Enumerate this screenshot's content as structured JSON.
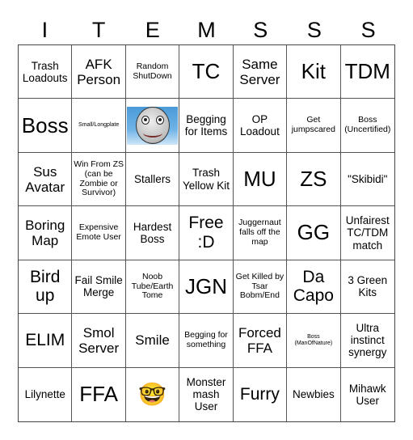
{
  "title_letters": [
    "I",
    "T",
    "E",
    "M",
    "S",
    "S",
    "S"
  ],
  "cells": [
    {
      "text": "Trash Loadouts",
      "size": "s-m"
    },
    {
      "text": "AFK Person",
      "size": "s-l"
    },
    {
      "text": "Random ShutDown",
      "size": "s-s"
    },
    {
      "text": "TC",
      "size": "s-xxl"
    },
    {
      "text": "Same Server",
      "size": "s-l"
    },
    {
      "text": "Kit",
      "size": "s-xxl"
    },
    {
      "text": "TDM",
      "size": "s-xxl"
    },
    {
      "text": "Boss",
      "size": "s-xxl"
    },
    {
      "text": "Small/Longplate",
      "size": "s-xs"
    },
    {
      "text": "",
      "size": "s-s",
      "image": "smiling-ball-face-image"
    },
    {
      "text": "Begging for Items",
      "size": "s-m"
    },
    {
      "text": "OP Loadout",
      "size": "s-m"
    },
    {
      "text": "Get jumpscared",
      "size": "s-s"
    },
    {
      "text": "Boss (Uncertified)",
      "size": "s-s"
    },
    {
      "text": "Sus Avatar",
      "size": "s-l"
    },
    {
      "text": "Win From ZS (can be Zombie or Survivor)",
      "size": "s-s"
    },
    {
      "text": "Stallers",
      "size": "s-m"
    },
    {
      "text": "Trash Yellow Kit",
      "size": "s-m"
    },
    {
      "text": "MU",
      "size": "s-xxl"
    },
    {
      "text": "ZS",
      "size": "s-xxl"
    },
    {
      "text": "\"Skibidi\"",
      "size": "s-m"
    },
    {
      "text": "Boring Map",
      "size": "s-l"
    },
    {
      "text": "Expensive Emote User",
      "size": "s-s"
    },
    {
      "text": "Hardest Boss",
      "size": "s-m"
    },
    {
      "text": "Free :D",
      "size": "s-xl"
    },
    {
      "text": "Juggernaut falls off the map",
      "size": "s-s"
    },
    {
      "text": "GG",
      "size": "s-xxl"
    },
    {
      "text": "Unfairest TC/TDM match",
      "size": "s-m"
    },
    {
      "text": "Bird up",
      "size": "s-xl"
    },
    {
      "text": "Fail Smile Merge",
      "size": "s-m"
    },
    {
      "text": "Noob Tube/Earth Tome",
      "size": "s-s"
    },
    {
      "text": "JGN",
      "size": "s-xxl"
    },
    {
      "text": "Get Killed by Tsar Bobm/End",
      "size": "s-s"
    },
    {
      "text": "Da Capo",
      "size": "s-xl"
    },
    {
      "text": "3 Green Kits",
      "size": "s-m"
    },
    {
      "text": "ELIM",
      "size": "s-xl"
    },
    {
      "text": "Smol Server",
      "size": "s-l"
    },
    {
      "text": "Smile",
      "size": "s-l"
    },
    {
      "text": "Begging for something",
      "size": "s-s"
    },
    {
      "text": "Forced FFA",
      "size": "s-l"
    },
    {
      "text": "Boss (ManOfNature)",
      "size": "s-xs"
    },
    {
      "text": "Ultra instinct synergy",
      "size": "s-m"
    },
    {
      "text": "Lilynette",
      "size": "s-m"
    },
    {
      "text": "FFA",
      "size": "s-xxl"
    },
    {
      "text": "🤓",
      "size": "emoji"
    },
    {
      "text": "Monster mash User",
      "size": "s-m"
    },
    {
      "text": "Furry",
      "size": "s-xl"
    },
    {
      "text": "Newbies",
      "size": "s-m"
    },
    {
      "text": "Mihawk User",
      "size": "s-m"
    }
  ]
}
